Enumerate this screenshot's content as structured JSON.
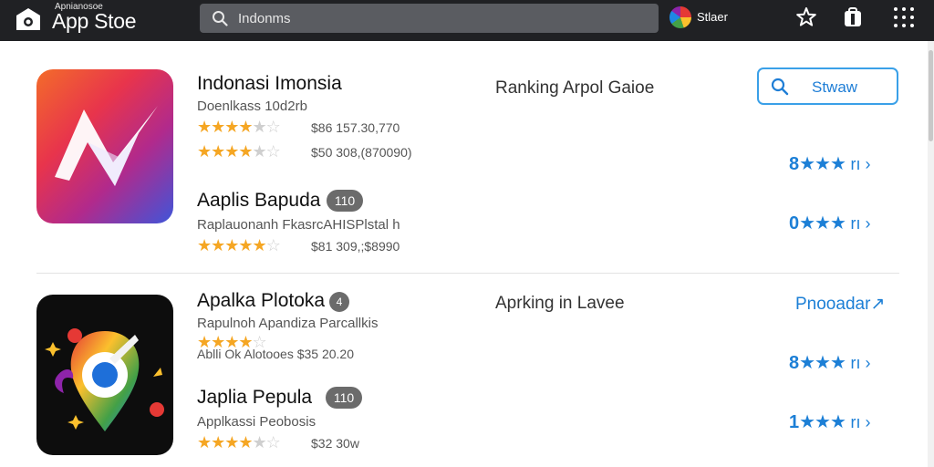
{
  "topbar": {
    "brand_small": "Apnianosoe",
    "brand": "App Stoe",
    "search": {
      "value": "Indonms",
      "placeholder": "Indonms"
    },
    "user_name": "Stlaer",
    "icons": [
      "app-store-logo-icon",
      "search-icon",
      "star-icon",
      "shopping-bag-icon",
      "grid-menu-icon"
    ]
  },
  "section1": {
    "heading": "Ranking Arpol Gaioe",
    "store_button": "Stwaw",
    "apps": [
      {
        "title": "Indonasi Imonsia",
        "subtitle": "Doenlkass 10d2rb",
        "rating_rows": [
          {
            "stars": 4,
            "meta": "$86 157.30,770"
          },
          {
            "stars": 4,
            "meta": "$50 308,(870090)"
          }
        ]
      },
      {
        "title": "Aaplis Bapuda",
        "badge": "110",
        "subtitle": "Raplauonanh FkasrcAHISPlstal h",
        "rating_rows": [
          {
            "stars": 5,
            "meta": "$81 309,;$8990"
          }
        ]
      }
    ],
    "rating_links": [
      {
        "lead": "8",
        "stars": "★★★",
        "tail": "rı ›"
      },
      {
        "lead": "0",
        "stars": "★★★",
        "tail": "rı ›"
      }
    ]
  },
  "section2": {
    "heading": "Aprking in Lavee",
    "download_link": "Pnooadar↗",
    "apps": [
      {
        "title": "Apalka Plotoka",
        "badge": "4",
        "subtitle": "Rapulnoh Apandiza Parcallkis",
        "rating_rows": [
          {
            "stars": 4,
            "meta": "Ablli Ok Alotooes  $35 20.20"
          }
        ]
      },
      {
        "title": "Japlia Pepula",
        "badge": "110",
        "subtitle": "Applkassi Peobosis",
        "rating_rows": [
          {
            "stars": 4,
            "meta": "$32 30w"
          }
        ]
      }
    ],
    "rating_links": [
      {
        "lead": "8",
        "stars": "★★★",
        "tail": "rı ›"
      },
      {
        "lead": "1",
        "stars": "★★★",
        "tail": "rı ›"
      }
    ]
  },
  "colors": {
    "topbar": "#202124",
    "accent_blue": "#1c7fd6",
    "star_gold": "#f5a623",
    "badge_gray": "#6b6b6b"
  }
}
